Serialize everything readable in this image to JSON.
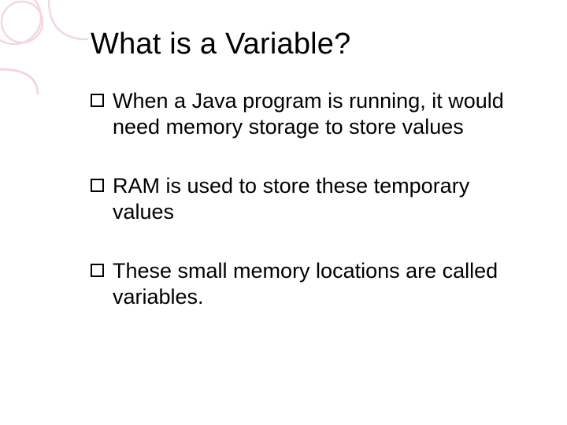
{
  "slide": {
    "title": "What is a Variable?",
    "bullets": [
      {
        "first": "When",
        "rest": " a Java program is running,  it would need memory storage to store values"
      },
      {
        "first": "RAM",
        "rest": " is used to store these temporary values"
      },
      {
        "first": "These",
        "rest": " small memory locations are called variables."
      }
    ]
  }
}
